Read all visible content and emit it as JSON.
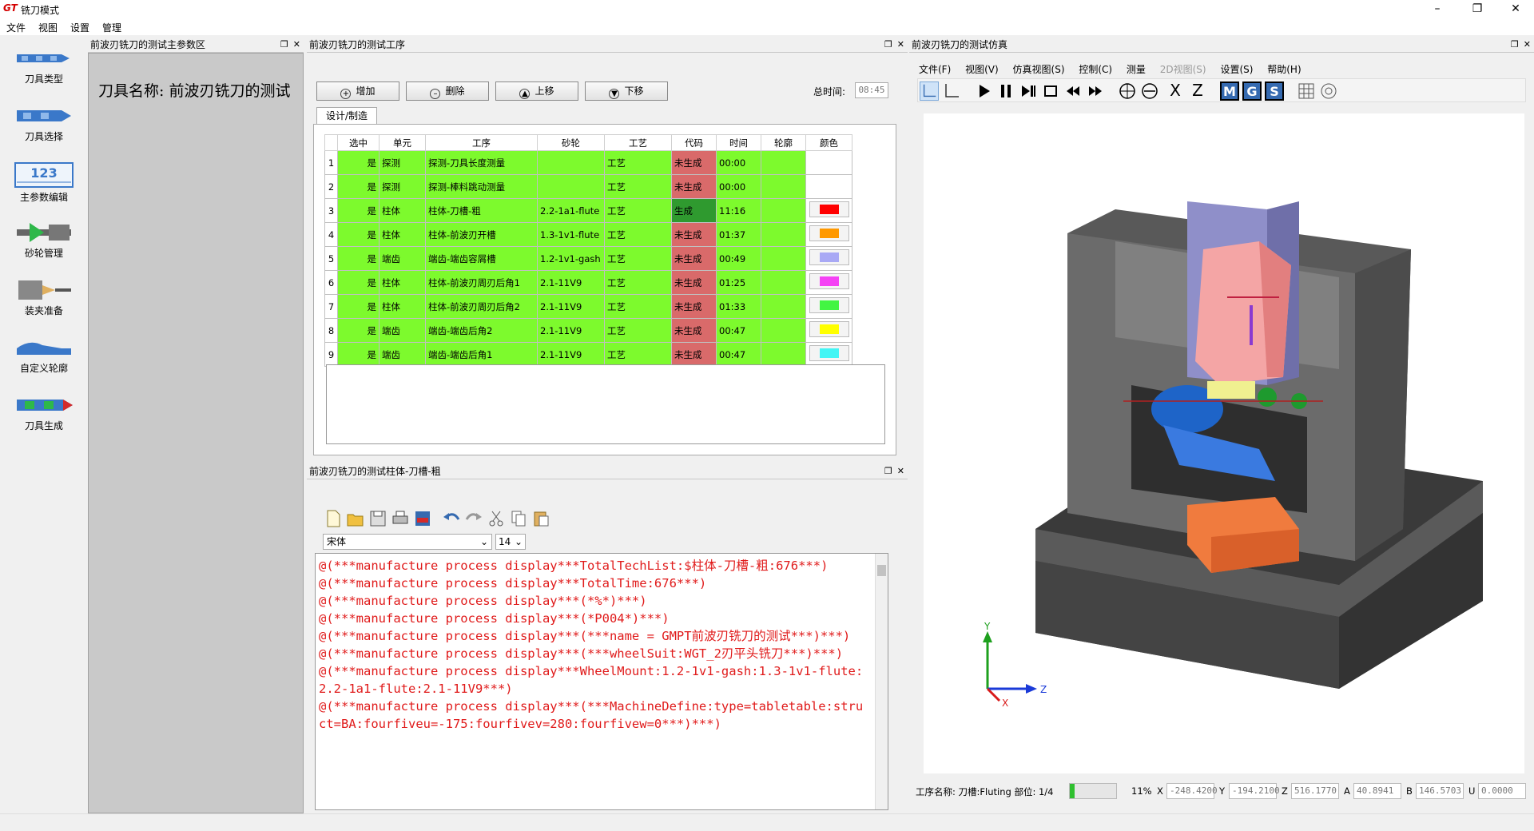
{
  "app": {
    "logo": "GT",
    "title": "铣刀模式"
  },
  "menu": [
    "文件",
    "视图",
    "设置",
    "管理"
  ],
  "left_tools": [
    "刀具类型",
    "刀具选择",
    "主参数编辑",
    "砂轮管理",
    "装夹准备",
    "自定义轮廓",
    "刀具生成"
  ],
  "param_panel": {
    "title": "前波刃铣刀的测试主参数区",
    "tool_name": "刀具名称: 前波刃铣刀的测试"
  },
  "proc_panel": {
    "title": "前波刃铣刀的测试工序",
    "buttons": {
      "add": "增加",
      "delete": "删除",
      "up": "上移",
      "down": "下移"
    },
    "total_label": "总时间:",
    "total_value": "08:45",
    "tab": "设计/制造",
    "headers": [
      "选中",
      "单元",
      "工序",
      "砂轮",
      "工艺",
      "代码",
      "时间",
      "轮廓",
      "颜色"
    ],
    "rows": [
      {
        "n": "1",
        "sel": "是",
        "unit": "探测",
        "proc": "探测-刀具长度测量",
        "wheel": "",
        "tech": "工艺",
        "code": "未生成",
        "time": "00:00",
        "color": ""
      },
      {
        "n": "2",
        "sel": "是",
        "unit": "探测",
        "proc": "探测-棒料跳动测量",
        "wheel": "",
        "tech": "工艺",
        "code": "未生成",
        "time": "00:00",
        "color": ""
      },
      {
        "n": "3",
        "sel": "是",
        "unit": "柱体",
        "proc": "柱体-刀槽-粗",
        "wheel": "2.2-1a1-flute",
        "tech": "工艺",
        "code": "生成",
        "time": "11:16",
        "color": "#ff0000"
      },
      {
        "n": "4",
        "sel": "是",
        "unit": "柱体",
        "proc": "柱体-前波刃开槽",
        "wheel": "1.3-1v1-flute",
        "tech": "工艺",
        "code": "未生成",
        "time": "01:37",
        "color": "#ff9900"
      },
      {
        "n": "5",
        "sel": "是",
        "unit": "端齿",
        "proc": "端齿-端齿容屑槽",
        "wheel": "1.2-1v1-gash",
        "tech": "工艺",
        "code": "未生成",
        "time": "00:49",
        "color": "#a9a9f5"
      },
      {
        "n": "6",
        "sel": "是",
        "unit": "柱体",
        "proc": "柱体-前波刃周刃后角1",
        "wheel": "2.1-11V9",
        "tech": "工艺",
        "code": "未生成",
        "time": "01:25",
        "color": "#f542f5"
      },
      {
        "n": "7",
        "sel": "是",
        "unit": "柱体",
        "proc": "柱体-前波刃周刃后角2",
        "wheel": "2.1-11V9",
        "tech": "工艺",
        "code": "未生成",
        "time": "01:33",
        "color": "#42f542"
      },
      {
        "n": "8",
        "sel": "是",
        "unit": "端齿",
        "proc": "端齿-端齿后角2",
        "wheel": "2.1-11V9",
        "tech": "工艺",
        "code": "未生成",
        "time": "00:47",
        "color": "#ffff00"
      },
      {
        "n": "9",
        "sel": "是",
        "unit": "端齿",
        "proc": "端齿-端齿后角1",
        "wheel": "2.1-11V9",
        "tech": "工艺",
        "code": "未生成",
        "time": "00:47",
        "color": "#42f5f5"
      }
    ]
  },
  "code_panel": {
    "title": "前波刃铣刀的测试柱体-刀槽-粗",
    "font": "宋体",
    "size": "14",
    "lines": [
      "@(***manufacture process display***TotalTechList:$柱体-刀槽-粗:676***)",
      "@(***manufacture process display***TotalTime:676***)",
      "@(***manufacture process display***(*%*)***)",
      "@(***manufacture process display***(*P004*)***)",
      "@(***manufacture process display***(***name = GMPT前波刃铣刀的测试***)***)",
      "@(***manufacture process display***(***wheelSuit:WGT_2刃平头铣刀***)***)",
      "@(***manufacture process display***WheelMount:1.2-1v1-gash:1.3-1v1-flute:2.2-1a1-flute:2.1-11V9***)",
      "@(***manufacture process display***(***MachineDefine:type=tabletable:struct=BA:fourfiveu=-175:fourfivev=280:fourfivew=0***)***)"
    ]
  },
  "sim_panel": {
    "title": "前波刃铣刀的测试仿真",
    "menu": [
      "文件(F)",
      "视图(V)",
      "仿真视图(S)",
      "控制(C)",
      "测量",
      "2D视图(S)",
      "设置(S)",
      "帮助(H)"
    ],
    "toolbar_letters": {
      "x": "X",
      "z": "Z",
      "m": "M",
      "g": "G",
      "s": "S"
    },
    "axis": {
      "y": "Y",
      "z": "Z",
      "x": "X"
    },
    "status": {
      "proc_label": "工序名称: 刀槽:Fluting 部位: 1/4",
      "percent": "11%",
      "progress": 0.11,
      "x_label": "X",
      "x_val": "-248.4200",
      "y_label": "Y",
      "y_val": "-194.2100",
      "z_label": "Z",
      "z_val": "516.1770",
      "a_label": "A",
      "a_val": "40.8941",
      "b_label": "B",
      "b_val": "146.5703",
      "u_label": "U",
      "u_val": "0.0000"
    }
  },
  "colors": {
    "green_cell": "#7dfa2d",
    "red_code": "#d96a6a",
    "done_code": "#2f9a2f",
    "code_text": "#e01a1a"
  }
}
